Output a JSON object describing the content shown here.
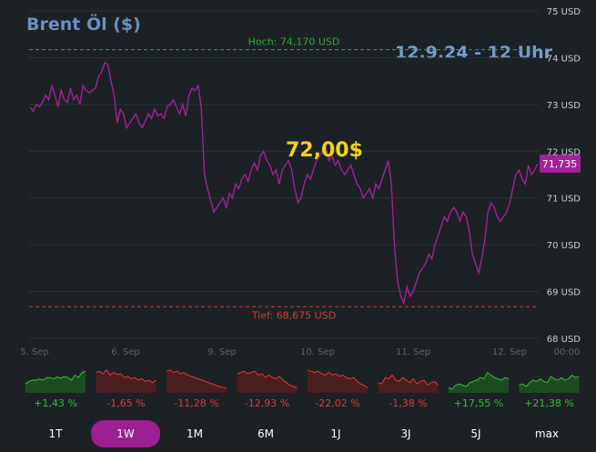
{
  "header": {
    "title": "Brent Öl ($)",
    "timestamp": "12.9.24 - 12 Uhr",
    "callout": "72,00$"
  },
  "chart_data": {
    "type": "line",
    "ylim": [
      68,
      75
    ],
    "y_ticks": [
      {
        "value": 75,
        "label": "75 USD"
      },
      {
        "value": 74,
        "label": "74 USD"
      },
      {
        "value": 73,
        "label": "73 USD"
      },
      {
        "value": 72,
        "label": "72 USD"
      },
      {
        "value": 71,
        "label": "71 USD"
      },
      {
        "value": 70,
        "label": "70 USD"
      },
      {
        "value": 69,
        "label": "69 USD"
      },
      {
        "value": 68,
        "label": "68 USD"
      }
    ],
    "x_ticks": [
      "5. Sep",
      "6. Sep",
      "9. Sep",
      "10. Sep",
      "11. Sep",
      "12. Sep",
      "00:00"
    ],
    "high": {
      "value": 74.17,
      "label": "Hoch: 74,170 USD"
    },
    "low": {
      "value": 68.675,
      "label": "Tief: 68,675 USD"
    },
    "last": {
      "value": 71.735,
      "label": "71,735"
    },
    "grid": true,
    "series": [
      {
        "color": "#a3219a",
        "values": [
          72.95,
          72.85,
          73.0,
          72.95,
          73.05,
          73.2,
          73.1,
          73.4,
          73.2,
          72.95,
          73.3,
          73.1,
          73.05,
          73.35,
          73.1,
          73.2,
          73.0,
          73.4,
          73.3,
          73.25,
          73.3,
          73.35,
          73.6,
          73.7,
          73.9,
          73.85,
          73.5,
          73.2,
          72.6,
          72.9,
          72.8,
          72.5,
          72.6,
          72.7,
          72.8,
          72.6,
          72.5,
          72.65,
          72.8,
          72.7,
          72.9,
          72.75,
          72.8,
          72.7,
          72.95,
          73.0,
          73.1,
          72.95,
          72.8,
          73.0,
          72.75,
          73.2,
          73.35,
          73.3,
          73.4,
          72.9,
          71.5,
          71.2,
          70.95,
          70.7,
          70.8,
          70.9,
          71.0,
          70.8,
          71.1,
          71.0,
          71.3,
          71.2,
          71.4,
          71.5,
          71.35,
          71.6,
          71.75,
          71.6,
          71.9,
          72.0,
          71.8,
          71.7,
          71.5,
          71.6,
          71.3,
          71.6,
          71.7,
          71.8,
          71.6,
          71.2,
          70.9,
          71.0,
          71.3,
          71.5,
          71.4,
          71.6,
          71.8,
          71.9,
          72.0,
          72.05,
          71.8,
          71.9,
          71.7,
          71.8,
          71.6,
          71.5,
          71.6,
          71.7,
          71.5,
          71.3,
          71.2,
          71.0,
          71.1,
          71.2,
          71.0,
          71.3,
          71.2,
          71.4,
          71.6,
          71.8,
          71.3,
          70.0,
          69.2,
          68.9,
          68.75,
          69.1,
          68.9,
          69.0,
          69.2,
          69.4,
          69.5,
          69.6,
          69.8,
          69.7,
          70.0,
          70.2,
          70.4,
          70.6,
          70.5,
          70.7,
          70.8,
          70.7,
          70.5,
          70.7,
          70.6,
          70.3,
          69.8,
          69.6,
          69.4,
          69.7,
          70.1,
          70.7,
          70.9,
          70.8,
          70.6,
          70.5,
          70.6,
          70.7,
          70.9,
          71.2,
          71.5,
          71.6,
          71.4,
          71.3,
          71.7,
          71.5,
          71.6,
          71.735
        ]
      }
    ]
  },
  "periods": [
    {
      "tab": "1T",
      "change": "+1,43 %",
      "dir": "up",
      "values": [
        0.35,
        0.45,
        0.5,
        0.5,
        0.55,
        0.5,
        0.6,
        0.6,
        0.55,
        0.62,
        0.58,
        0.65,
        0.6,
        0.5,
        0.7,
        0.6,
        0.8,
        0.85
      ]
    },
    {
      "tab": "1W",
      "change": "-1,65 %",
      "dir": "down",
      "values": [
        0.8,
        0.85,
        0.75,
        0.9,
        0.7,
        0.8,
        0.72,
        0.75,
        0.6,
        0.65,
        0.55,
        0.6,
        0.5,
        0.55,
        0.45,
        0.5,
        0.4,
        0.5
      ]
    },
    {
      "tab": "1M",
      "change": "-11,28 %",
      "dir": "down",
      "values": [
        0.85,
        0.9,
        0.8,
        0.85,
        0.75,
        0.8,
        0.7,
        0.65,
        0.6,
        0.55,
        0.5,
        0.45,
        0.4,
        0.35,
        0.3,
        0.25,
        0.22,
        0.18
      ]
    },
    {
      "tab": "6M",
      "change": "-12,93 %",
      "dir": "down",
      "values": [
        0.75,
        0.8,
        0.85,
        0.75,
        0.8,
        0.85,
        0.7,
        0.75,
        0.6,
        0.7,
        0.6,
        0.55,
        0.65,
        0.5,
        0.4,
        0.3,
        0.25,
        0.2
      ]
    },
    {
      "tab": "1J",
      "change": "-22,02 %",
      "dir": "down",
      "values": [
        0.9,
        0.85,
        0.8,
        0.85,
        0.75,
        0.7,
        0.8,
        0.7,
        0.75,
        0.65,
        0.7,
        0.6,
        0.55,
        0.6,
        0.45,
        0.35,
        0.3,
        0.2
      ]
    },
    {
      "tab": "3J",
      "change": "-1,38 %",
      "dir": "down",
      "values": [
        0.4,
        0.35,
        0.6,
        0.55,
        0.7,
        0.5,
        0.45,
        0.6,
        0.5,
        0.4,
        0.55,
        0.35,
        0.45,
        0.5,
        0.3,
        0.4,
        0.45,
        0.3
      ]
    },
    {
      "tab": "5J",
      "change": "+17,55 %",
      "dir": "up",
      "values": [
        0.2,
        0.15,
        0.3,
        0.35,
        0.3,
        0.25,
        0.4,
        0.45,
        0.5,
        0.6,
        0.55,
        0.8,
        0.7,
        0.6,
        0.55,
        0.5,
        0.6,
        0.55
      ]
    },
    {
      "tab": "max",
      "change": "+21,38 %",
      "dir": "up",
      "values": [
        0.3,
        0.35,
        0.25,
        0.4,
        0.5,
        0.45,
        0.55,
        0.45,
        0.4,
        0.65,
        0.55,
        0.5,
        0.6,
        0.5,
        0.55,
        0.7,
        0.6,
        0.65
      ]
    }
  ],
  "active_period": "1W",
  "colors": {
    "up": "#35c038",
    "down": "#e03a3a",
    "line": "#a3219a",
    "high": "#2fa83a",
    "low": "#d33c3c"
  }
}
